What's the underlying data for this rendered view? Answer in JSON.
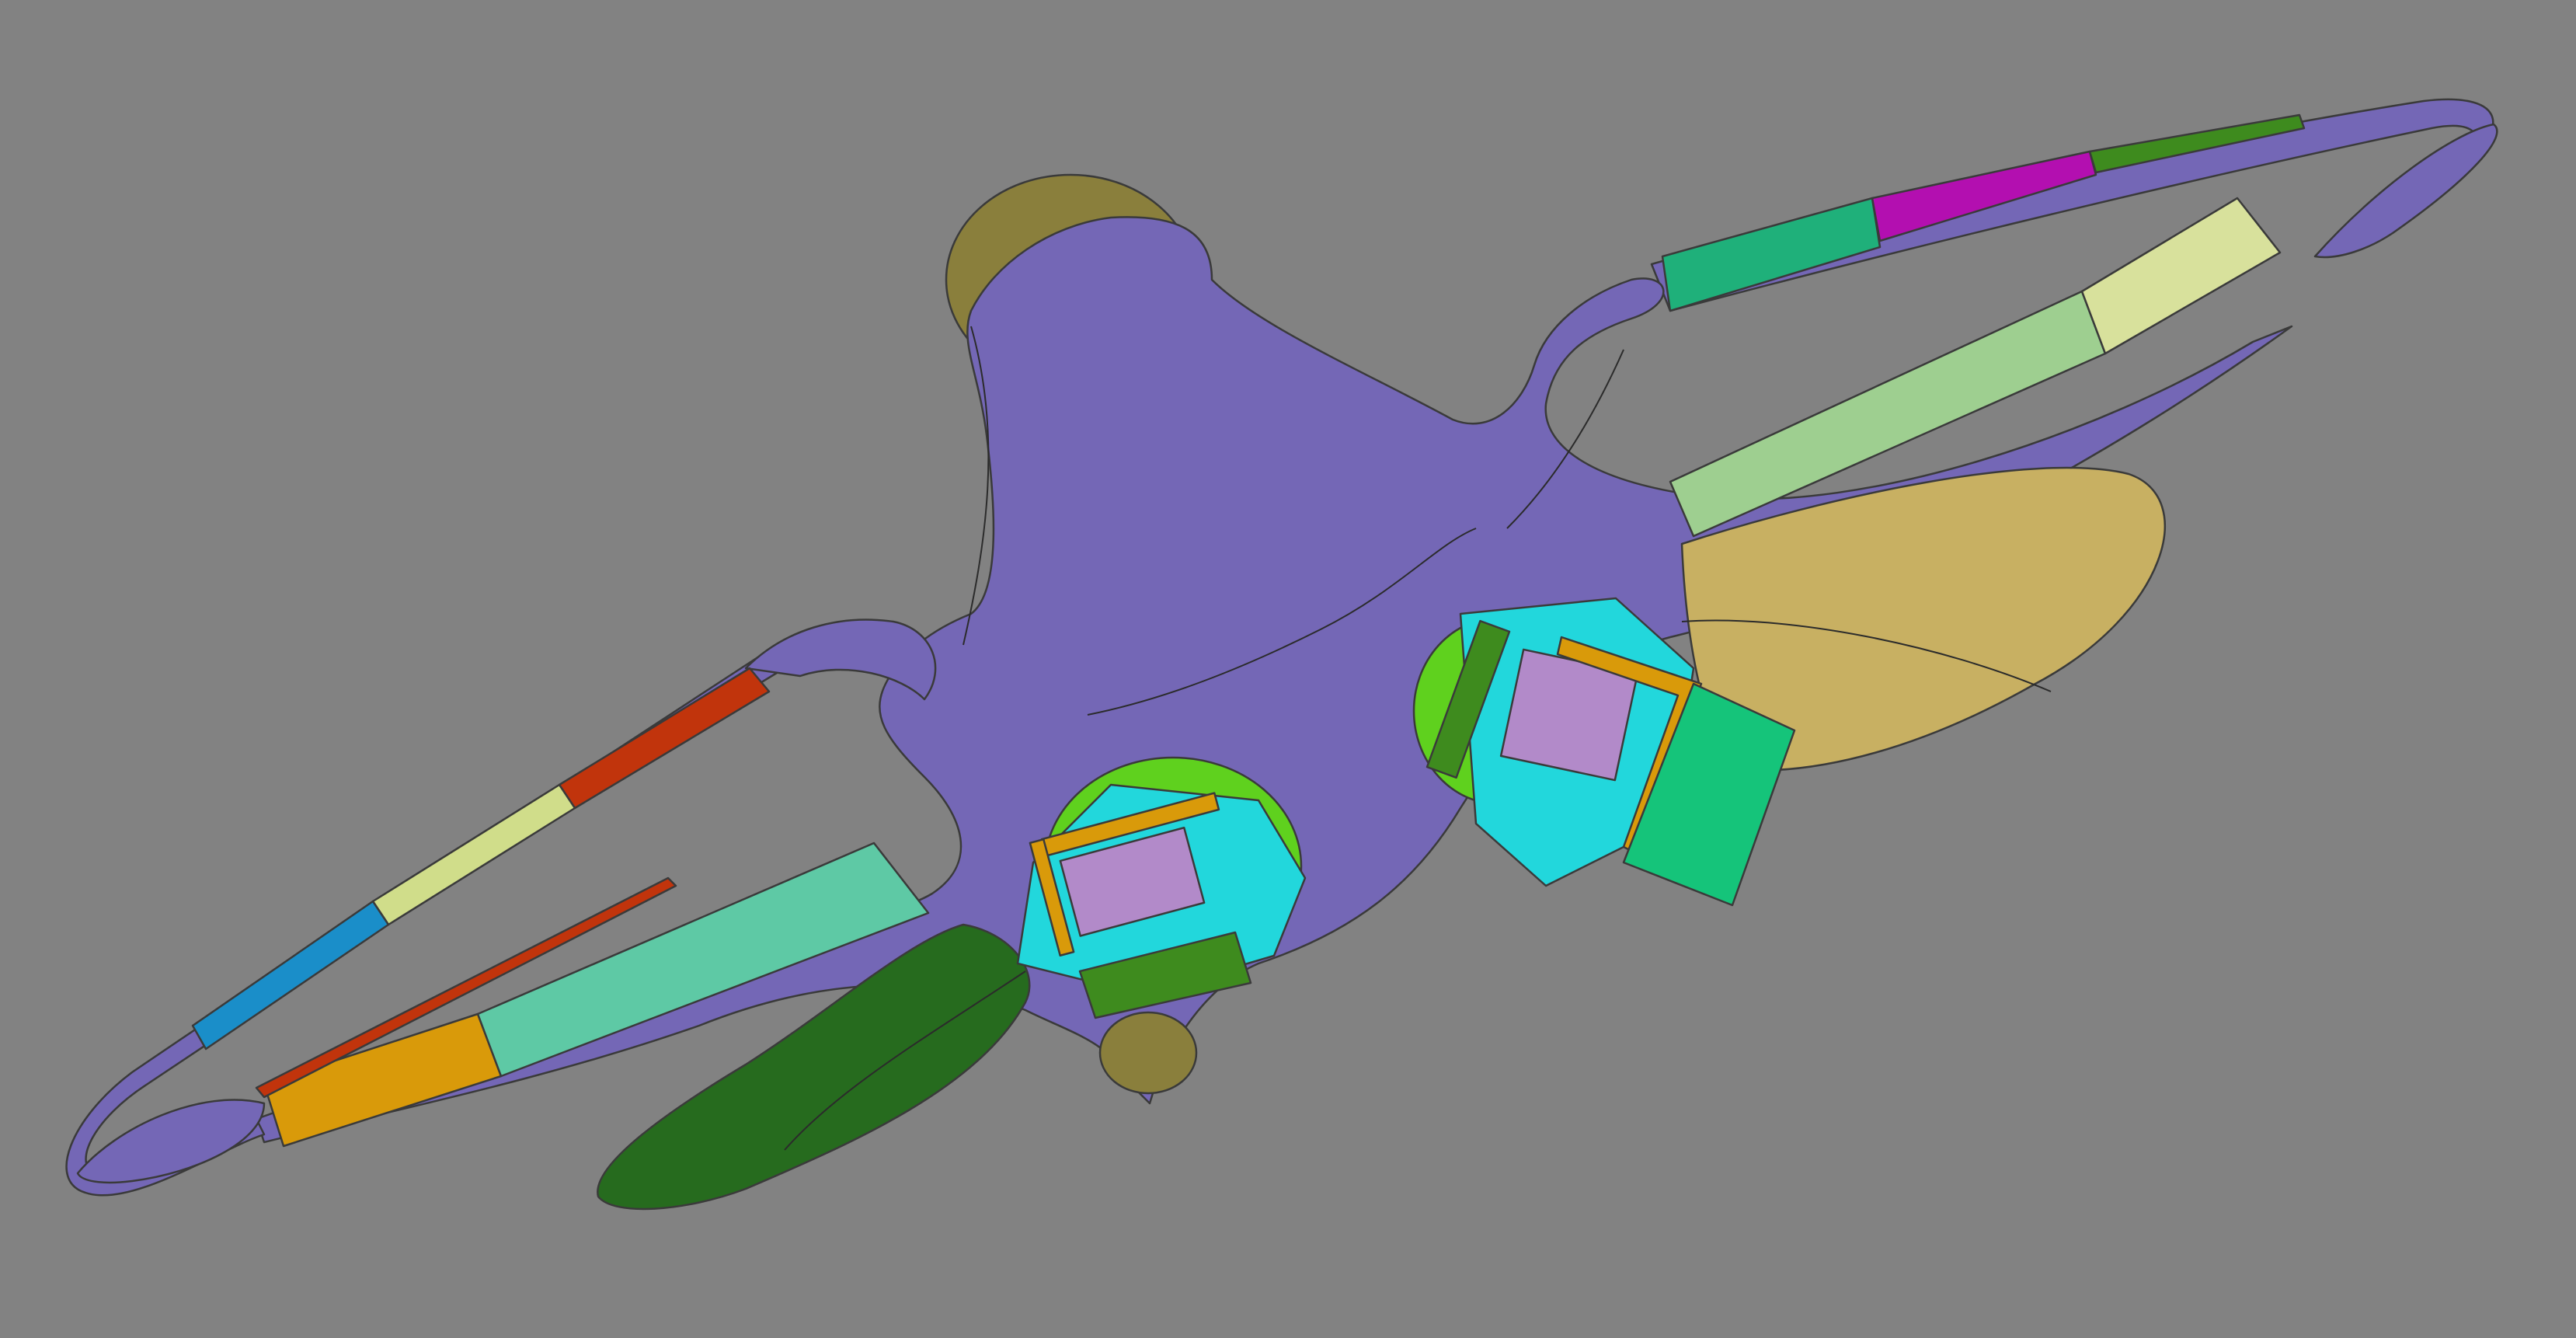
{
  "view": {
    "background": "#828282"
  },
  "palette": {
    "body": "#7467b6",
    "body_dark": "#5f54a0",
    "dome": "#8a7f3c",
    "fin_yellow": "#c8b062",
    "fin_green": "#266b1e",
    "seg_green_teal": "#1fb07a",
    "seg_magenta": "#b30fb0",
    "seg_dark_green": "#3e8b1e",
    "seg_light_green": "#9ecf90",
    "seg_pale_yellow": "#d8e19c",
    "seg_red": "#c1340c",
    "seg_pale_lime": "#d0dd8a",
    "seg_blue": "#1a8ec9",
    "seg_orange": "#d99a0a",
    "seg_mint": "#5ec9a5",
    "cyan": "#22d7dc",
    "lime": "#5fd11e",
    "lavender": "#b28ac9",
    "mod_green": "#15c47a"
  }
}
